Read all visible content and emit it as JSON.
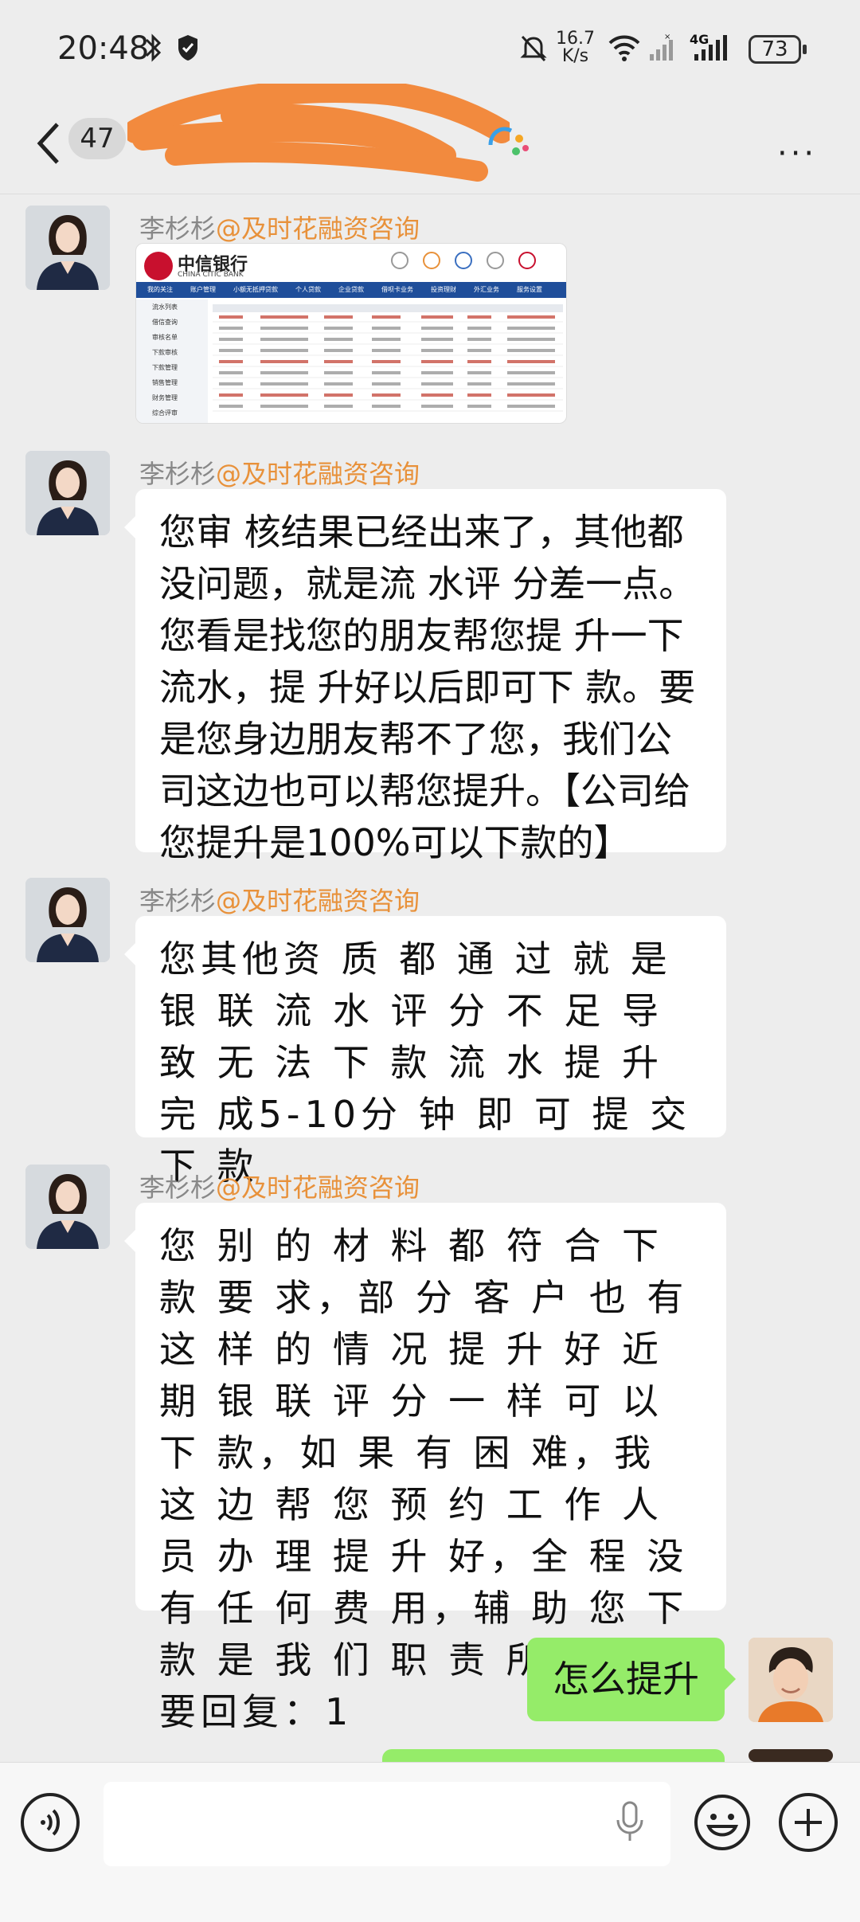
{
  "status_bar": {
    "time": "20:48",
    "net_speed_value": "16.7",
    "net_speed_unit": "K/s",
    "network": "4G",
    "battery": "73"
  },
  "header": {
    "unread_count": "47",
    "more": "···"
  },
  "messages": [
    {
      "sender": "李杉杉",
      "org": "@及时花融资咨询",
      "type": "image",
      "image": {
        "bank_name": "中信银行",
        "bank_name_en": "CHINA CITIC BANK",
        "nav": [
          "我的关注",
          "账户管理",
          "小额无抵押贷款",
          "个人贷款",
          "企业贷款",
          "借呗卡业务",
          "投资理财",
          "外汇业务",
          "服务设置"
        ],
        "side": [
          "流水列表",
          "借信查询",
          "审核名单",
          "下款审核",
          "下款管理",
          "销售管理",
          "财务管理",
          "综合评审"
        ]
      }
    },
    {
      "sender": "李杉杉",
      "org": "@及时花融资咨询",
      "type": "text",
      "text": "您审 核结果已经出来了，其他都没问题，就是流 水评 分差一点。您看是找您的朋友帮您提 升一下流水，提 升好以后即可下 款。要是您身边朋友帮不了您，我们公司这边也可以帮您提升。【公司给您提升是100%可以下款的】"
    },
    {
      "sender": "李杉杉",
      "org": "@及时花融资咨询",
      "type": "text",
      "text": "您其他资 质 都 通 过 就 是 银 联 流 水 评 分 不 足 导 致 无 法 下 款 流 水 提 升完 成5-10分 钟 即 可 提 交 下 款"
    },
    {
      "sender": "李杉杉",
      "org": "@及时花融资咨询",
      "type": "text",
      "text": "您 别 的 材 料 都 符 合 下 款 要 求，部 分 客 户 也 有 这 样 的 情 况 提 升 好 近 期 银 联 评 分 一 样 可 以 下 款，如 果 有 困 难，我 这 边 帮 您 预 约 工 作 人 员 办 理 提 升 好，全 程 没 有 任 何 费 用，辅 助 您 下 款 是 我 们 职 责 所 在 (需要回复：1"
    }
  ],
  "my_messages": [
    {
      "text": "怎么提升"
    }
  ],
  "colors": {
    "background": "#ededed",
    "my_bubble": "#95ec69",
    "org_name": "#e8913a",
    "redaction": "#f28a3e"
  },
  "icons": {
    "back": "chevron-left-icon",
    "more": "more-dots-icon",
    "voice": "voice-icon",
    "mic": "microphone-icon",
    "emoji": "emoji-icon",
    "plus": "plus-icon"
  }
}
